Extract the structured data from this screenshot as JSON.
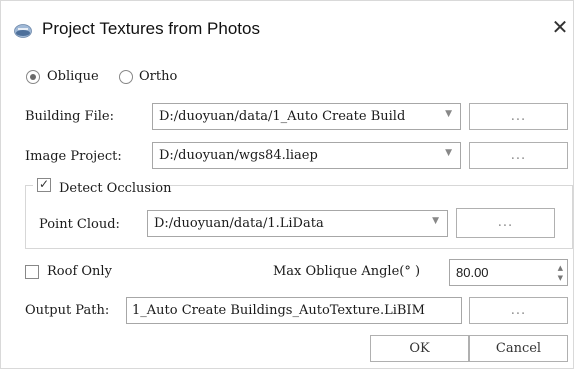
{
  "window": {
    "title": "Project Textures from Photos",
    "close_icon": "close-icon",
    "app_icon": "app-icon"
  },
  "mode": {
    "options": [
      {
        "label": "Oblique",
        "selected": true
      },
      {
        "label": "Ortho",
        "selected": false
      }
    ]
  },
  "building_file": {
    "label": "Building File:",
    "value": "D:/duoyuan/data/1_Auto Create Build",
    "browse_label": "..."
  },
  "image_project": {
    "label": "Image Project:",
    "value": "D:/duoyuan/wgs84.liaep",
    "browse_label": "..."
  },
  "detect_occlusion": {
    "label": "Detect Occlusion",
    "checked": true,
    "point_cloud": {
      "label": "Point Cloud:",
      "value": "D:/duoyuan/data/1.LiData",
      "browse_label": "..."
    }
  },
  "roof_only": {
    "label": "Roof Only",
    "checked": false
  },
  "max_oblique_angle": {
    "label": "Max Oblique Angle(° )",
    "value": "80.00"
  },
  "output_path": {
    "label": "Output Path:",
    "value": "1_Auto Create Buildings_AutoTexture.LiBIM",
    "browse_label": "..."
  },
  "buttons": {
    "ok": "OK",
    "cancel": "Cancel"
  }
}
